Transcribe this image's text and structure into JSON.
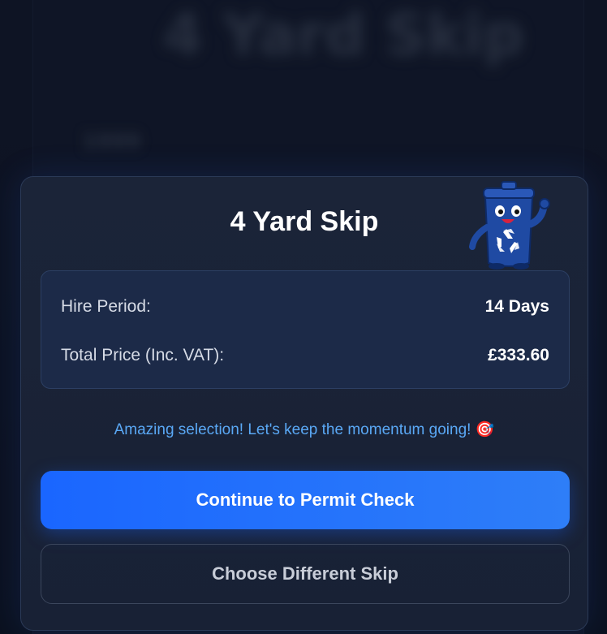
{
  "background": {
    "title": "4 Yard Skip",
    "subtitle": "1999"
  },
  "modal": {
    "title": "4 Yard Skip",
    "mascot_icon": "recycling-bin-mascot-icon",
    "details": [
      {
        "label": "Hire Period:",
        "value": "14 Days"
      },
      {
        "label": "Total Price (Inc. VAT):",
        "value": "£333.60"
      }
    ],
    "message": "Amazing selection! Let's keep the momentum going!",
    "message_emoji": "🎯",
    "primary_button": "Continue to Permit Check",
    "secondary_button": "Choose Different Skip"
  },
  "colors": {
    "accent": "#1a66ff",
    "message": "#5aa8f5",
    "modal_bg": "#1b2438"
  }
}
